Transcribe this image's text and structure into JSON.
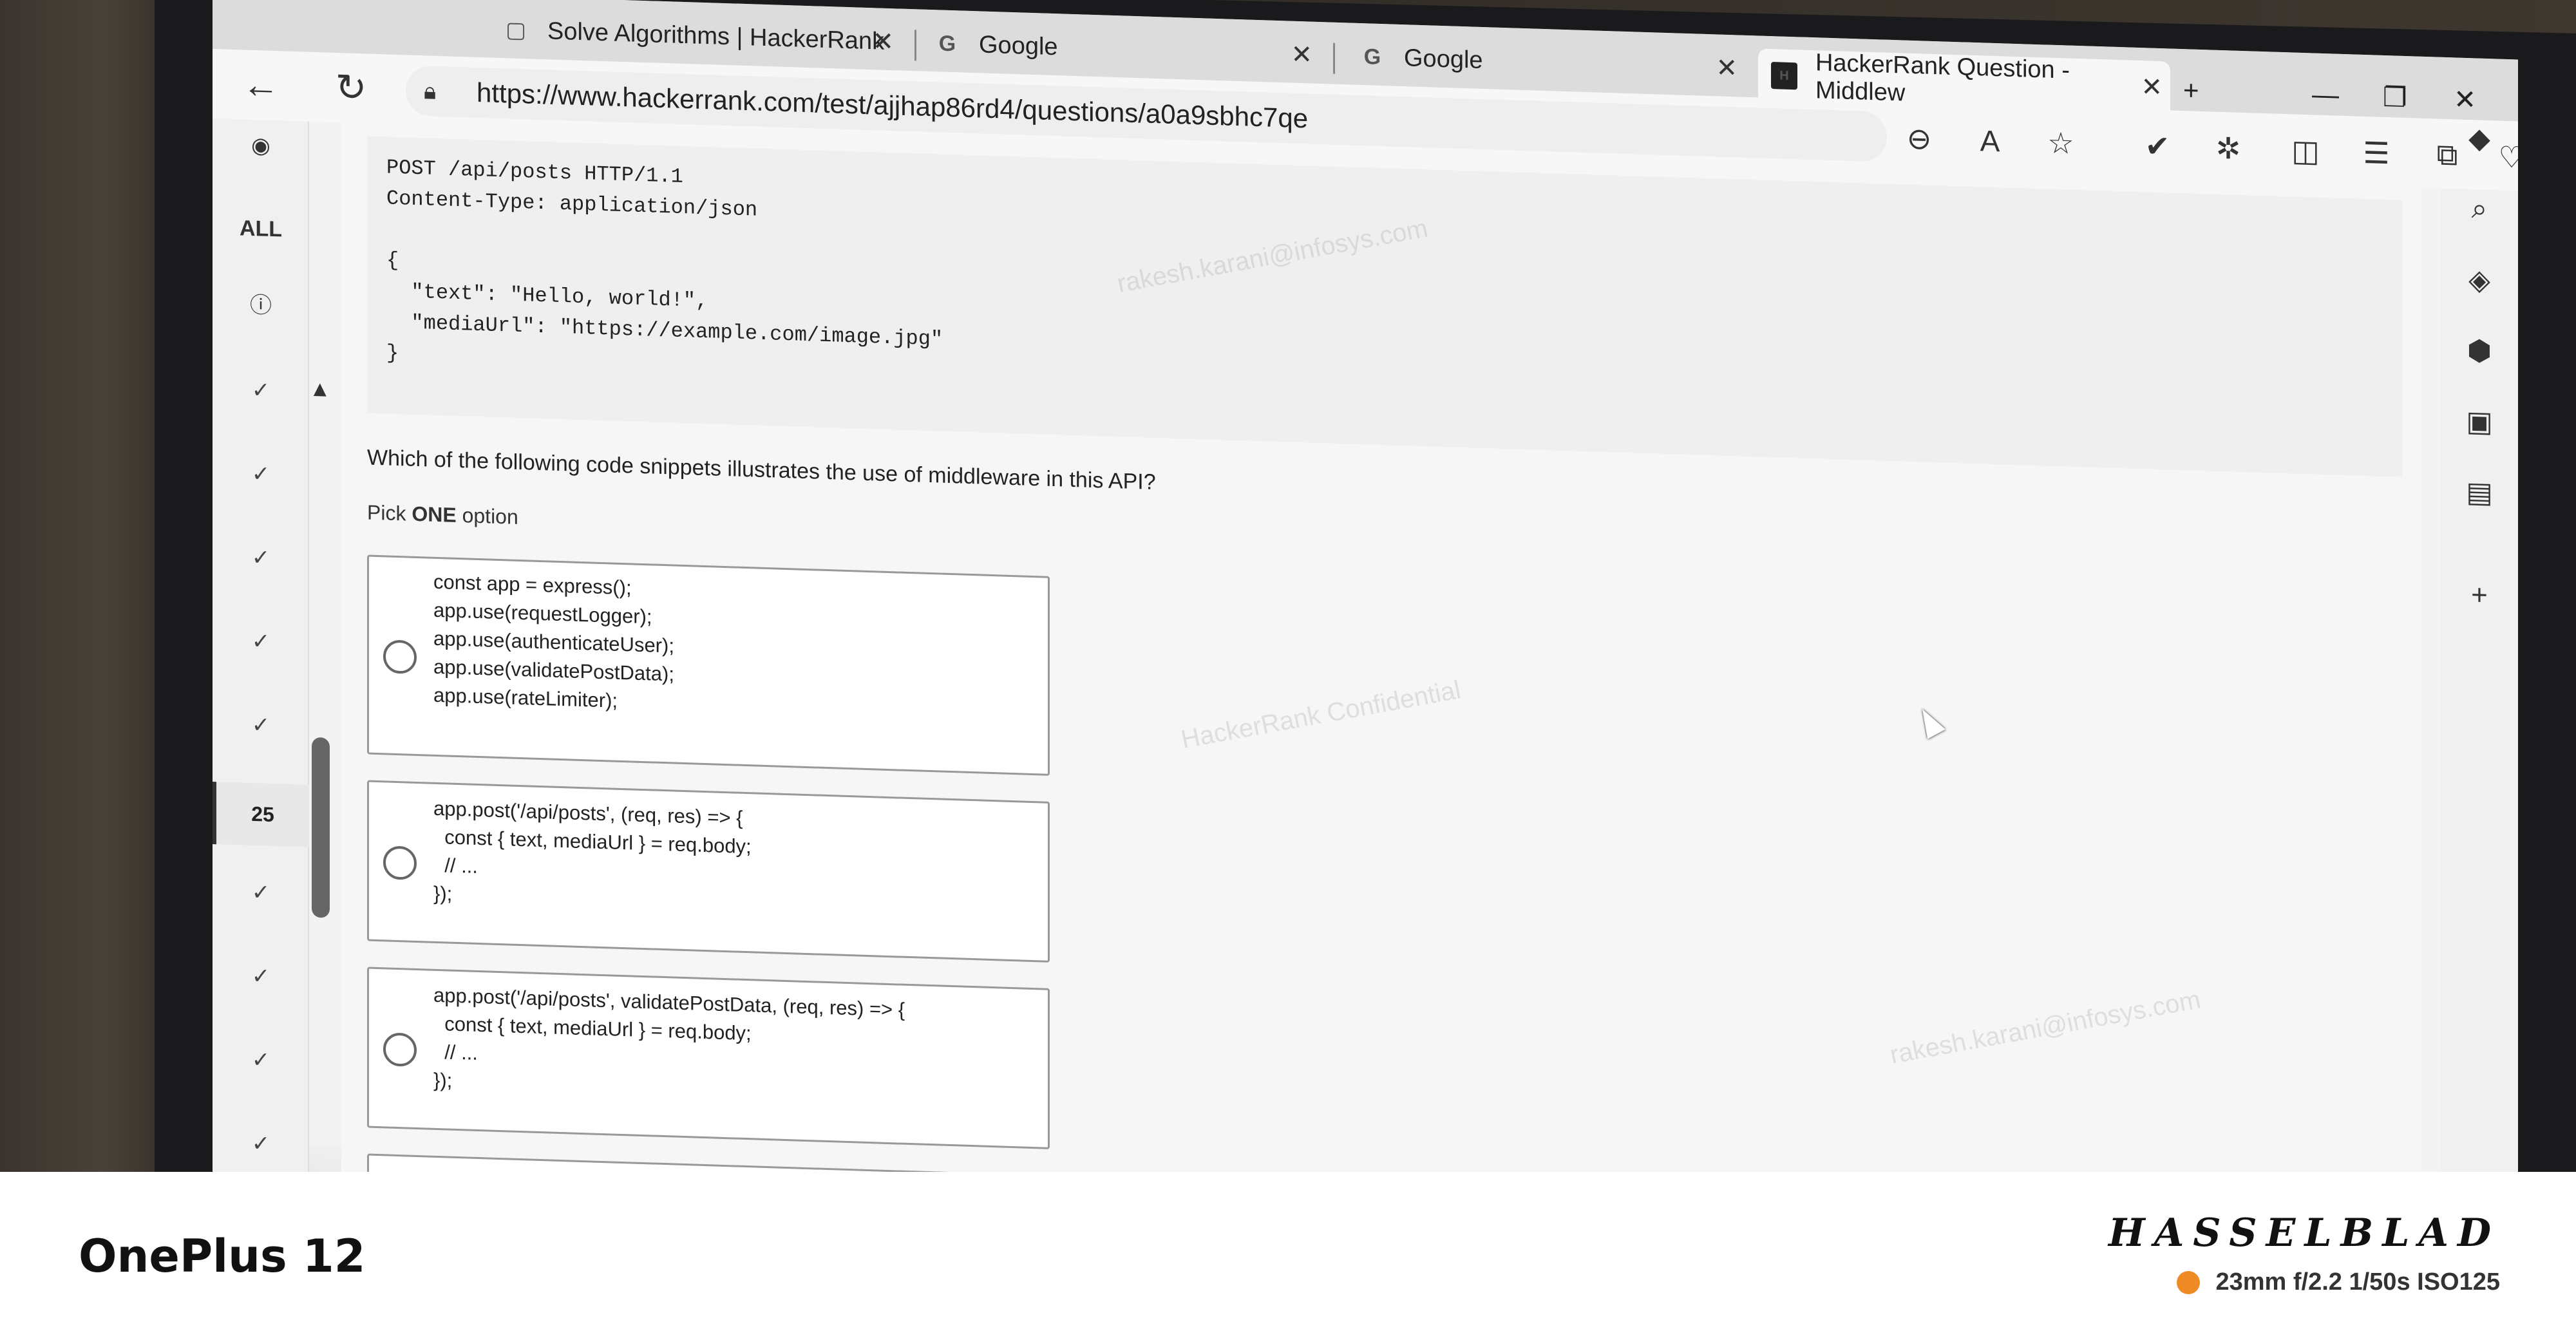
{
  "browser": {
    "tabs": [
      {
        "label": "Solve Algorithms | HackerRank",
        "icon": "page-icon",
        "active": false
      },
      {
        "label": "Google",
        "icon": "google-icon",
        "active": false
      },
      {
        "label": "Google",
        "icon": "google-icon",
        "active": false
      },
      {
        "label": "HackerRank Question - Middlew",
        "icon": "hackerrank-icon",
        "active": true
      }
    ],
    "new_tab_label": "+",
    "url": "https://www.hackerrank.com/test/ajjhap86rd4/questions/a0a9sbhc7qe"
  },
  "left_rail": {
    "all_label": "ALL",
    "current_question": "25"
  },
  "question": {
    "request_code": "POST /api/posts HTTP/1.1\nContent-Type: application/json\n\n{\n  \"text\": \"Hello, world!\",\n  \"mediaUrl\": \"https://example.com/image.jpg\"\n}",
    "text": "Which of the following code snippets illustrates the use of middleware in this API?",
    "pick_prefix": "Pick ",
    "pick_bold": "ONE",
    "pick_suffix": " option",
    "options": [
      {
        "code": "const app = express();\napp.use(requestLogger);\napp.use(authenticateUser);\napp.use(validatePostData);\napp.use(rateLimiter);"
      },
      {
        "code": "app.post('/api/posts', (req, res) => {\n  const { text, mediaUrl } = req.body;\n  // ...\n});"
      },
      {
        "code": "app.post('/api/posts', validatePostData, (req, res) => {\n  const { text, mediaUrl } = req.body;\n  // ...\n});"
      }
    ]
  },
  "watermarks": [
    "HackerRank Confidential",
    "rakesh.karani@infosys.com"
  ],
  "camera": {
    "model": "OnePlus 12",
    "brand": "HASSELBLAD",
    "exif": "23mm  f/2.2  1/50s  ISO125",
    "dot_color": "#f08a24"
  }
}
